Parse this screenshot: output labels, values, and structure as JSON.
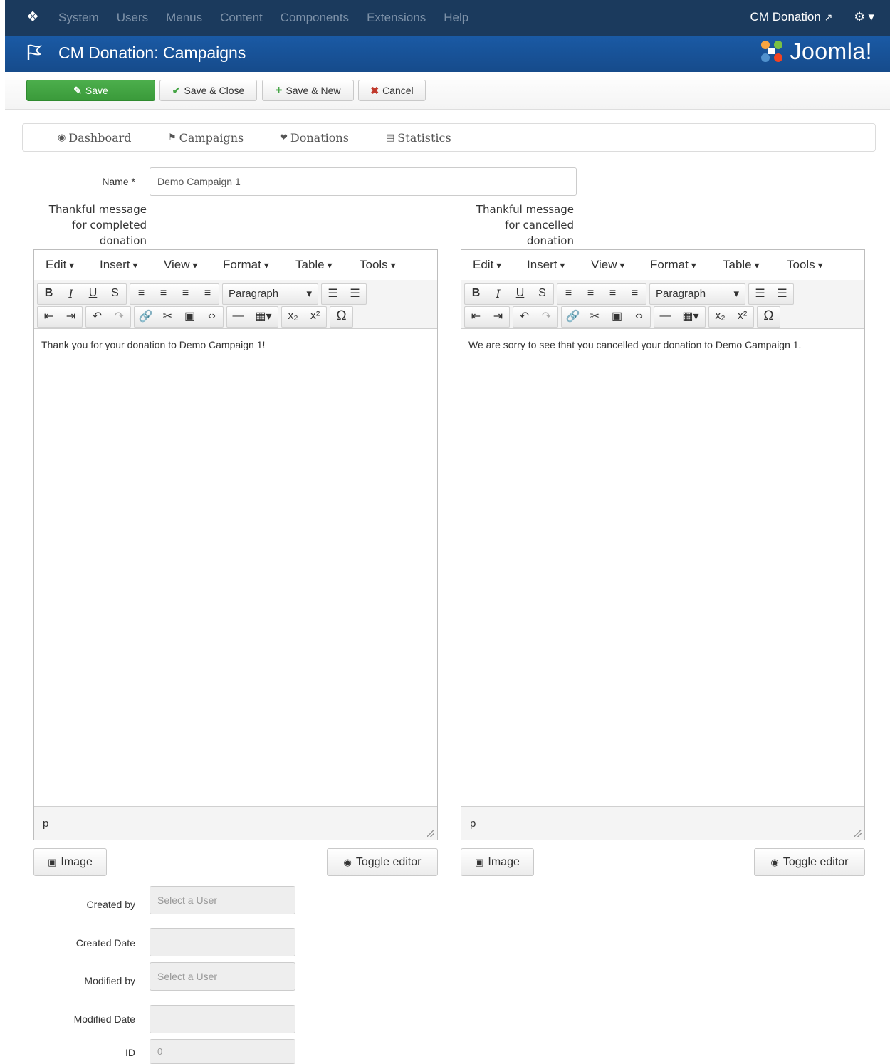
{
  "navbar": {
    "menu": [
      "System",
      "Users",
      "Menus",
      "Content",
      "Components",
      "Extensions",
      "Help"
    ],
    "site_link": "CM Donation"
  },
  "titlebar": {
    "title": "CM Donation: Campaigns",
    "logo_text": "Joomla!"
  },
  "toolbar": {
    "save": "Save",
    "save_close": "Save & Close",
    "save_new": "Save & New",
    "cancel": "Cancel"
  },
  "subnav": [
    "Dashboard",
    "Campaigns",
    "Donations",
    "Statistics"
  ],
  "form": {
    "name_label": "Name *",
    "name_value": "Demo Campaign 1",
    "completed_label": [
      "Thankful message",
      "for completed",
      "donation"
    ],
    "cancelled_label": [
      "Thankful message",
      "for cancelled",
      "donation"
    ],
    "created_by_label": "Created by",
    "created_by_placeholder": "Select a User",
    "created_date_label": "Created Date",
    "modified_by_label": "Modified by",
    "modified_by_placeholder": "Select a User",
    "modified_date_label": "Modified Date",
    "id_label": "ID",
    "id_value": "0"
  },
  "editor": {
    "menus": [
      "Edit",
      "Insert",
      "View",
      "Format",
      "Table",
      "Tools"
    ],
    "format_select": "Paragraph",
    "status_path": "p",
    "image_button": "Image",
    "toggle_button": "Toggle editor"
  },
  "editor_left": {
    "content": "Thank you for your donation to Demo Campaign 1!"
  },
  "editor_right": {
    "content": "We are sorry to see that you cancelled your donation to Demo Campaign 1."
  },
  "colors": {
    "navbar": "#1b3a5d",
    "titlebar": "#17509a",
    "save_green": "#46a546",
    "cancel_red": "#c0392b"
  }
}
